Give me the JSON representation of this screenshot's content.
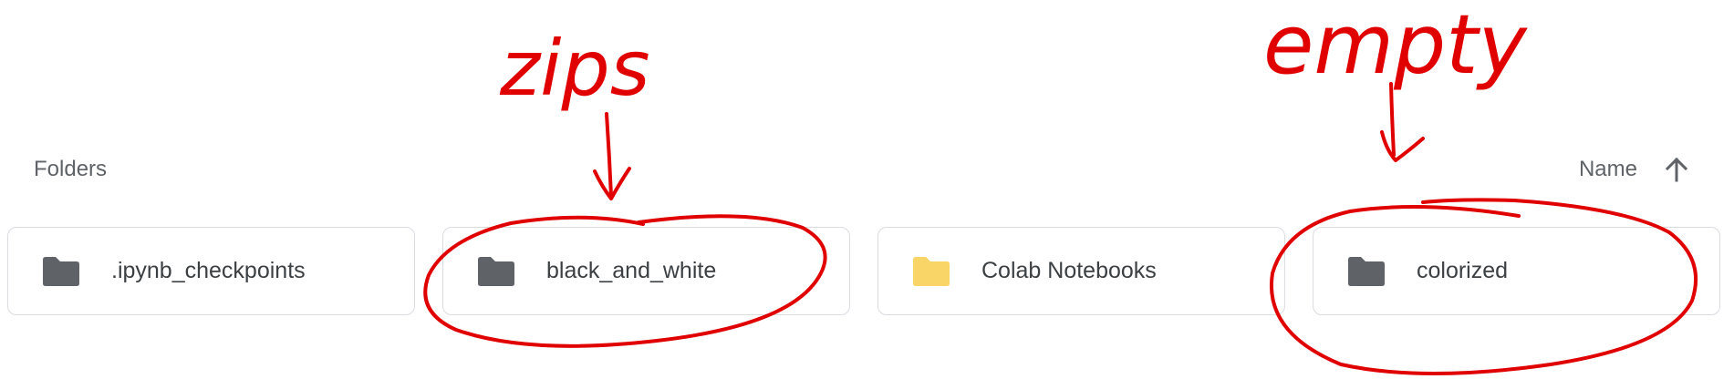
{
  "section": {
    "title": "Folders"
  },
  "sort": {
    "label": "Name",
    "direction_icon": "arrow-up-icon"
  },
  "folders": [
    {
      "name": ".ipynb_checkpoints",
      "icon": "folder-icon",
      "color": "#5f6368"
    },
    {
      "name": "black_and_white",
      "icon": "folder-icon",
      "color": "#5f6368"
    },
    {
      "name": "Colab Notebooks",
      "icon": "folder-icon",
      "color": "#f9d466"
    },
    {
      "name": "colorized",
      "icon": "folder-icon",
      "color": "#5f6368"
    }
  ],
  "annotations": {
    "note_zips": "zips",
    "note_empty": "empty",
    "ink_color": "#e00000"
  }
}
